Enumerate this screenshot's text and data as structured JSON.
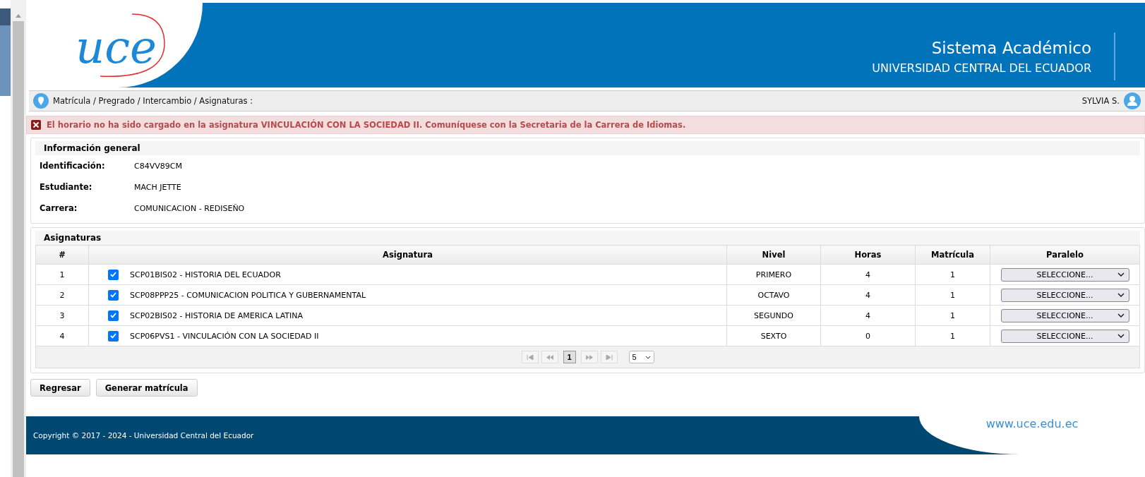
{
  "header": {
    "logo": "uce",
    "title": "Sistema Académico",
    "subtitle": "UNIVERSIDAD CENTRAL DEL ECUADOR"
  },
  "breadcrumb": "Matrícula / Pregrado / Intercambio / Asignaturas :",
  "user": "SYLVIA S.",
  "alert": "El horario no ha sido cargado en la asignatura VINCULACIÓN CON LA SOCIEDAD II. Comuníquese con la Secretaria de la Carrera de Idiomas.",
  "info": {
    "title": "Información general",
    "fields": [
      {
        "label": "Identificación:",
        "value": "C84VV89CM"
      },
      {
        "label": "Estudiante:",
        "value": "MACH JETTE"
      },
      {
        "label": "Carrera:",
        "value": "COMUNICACION - REDISEÑO"
      }
    ]
  },
  "subjects": {
    "title": "Asignaturas",
    "columns": [
      "#",
      "Asignatura",
      "Nivel",
      "Horas",
      "Matrícula",
      "Paralelo"
    ],
    "rows": [
      {
        "number": "1",
        "checked": true,
        "subject": "SCP01BIS02 - HISTORIA DEL ECUADOR",
        "level": "PRIMERO",
        "hours": "4",
        "enrollment": "1",
        "parallel": "SELECCIONE..."
      },
      {
        "number": "2",
        "checked": true,
        "subject": "SCP08PPP25 - COMUNICACION POLITICA Y GUBERNAMENTAL",
        "level": "OCTAVO",
        "hours": "4",
        "enrollment": "1",
        "parallel": "SELECCIONE..."
      },
      {
        "number": "3",
        "checked": true,
        "subject": "SCP02BIS02 - HISTORIA DE AMERICA LATINA",
        "level": "SEGUNDO",
        "hours": "4",
        "enrollment": "1",
        "parallel": "SELECCIONE..."
      },
      {
        "number": "4",
        "checked": true,
        "subject": "SCP06PVS1 - VINCULACIÓN CON LA SOCIEDAD II",
        "level": "SEXTO",
        "hours": "0",
        "enrollment": "1",
        "parallel": "SELECCIONE..."
      }
    ],
    "pagination": {
      "pages": [
        {
          "label": "1",
          "selected": true
        }
      ],
      "page_size": "5"
    }
  },
  "buttons": [
    "Regresar",
    "Generar matrícula"
  ],
  "footer": {
    "copyright": "Copyright © 2017 - 2024 - Universidad Central del Ecuador",
    "website": "www.uce.edu.ec"
  }
}
